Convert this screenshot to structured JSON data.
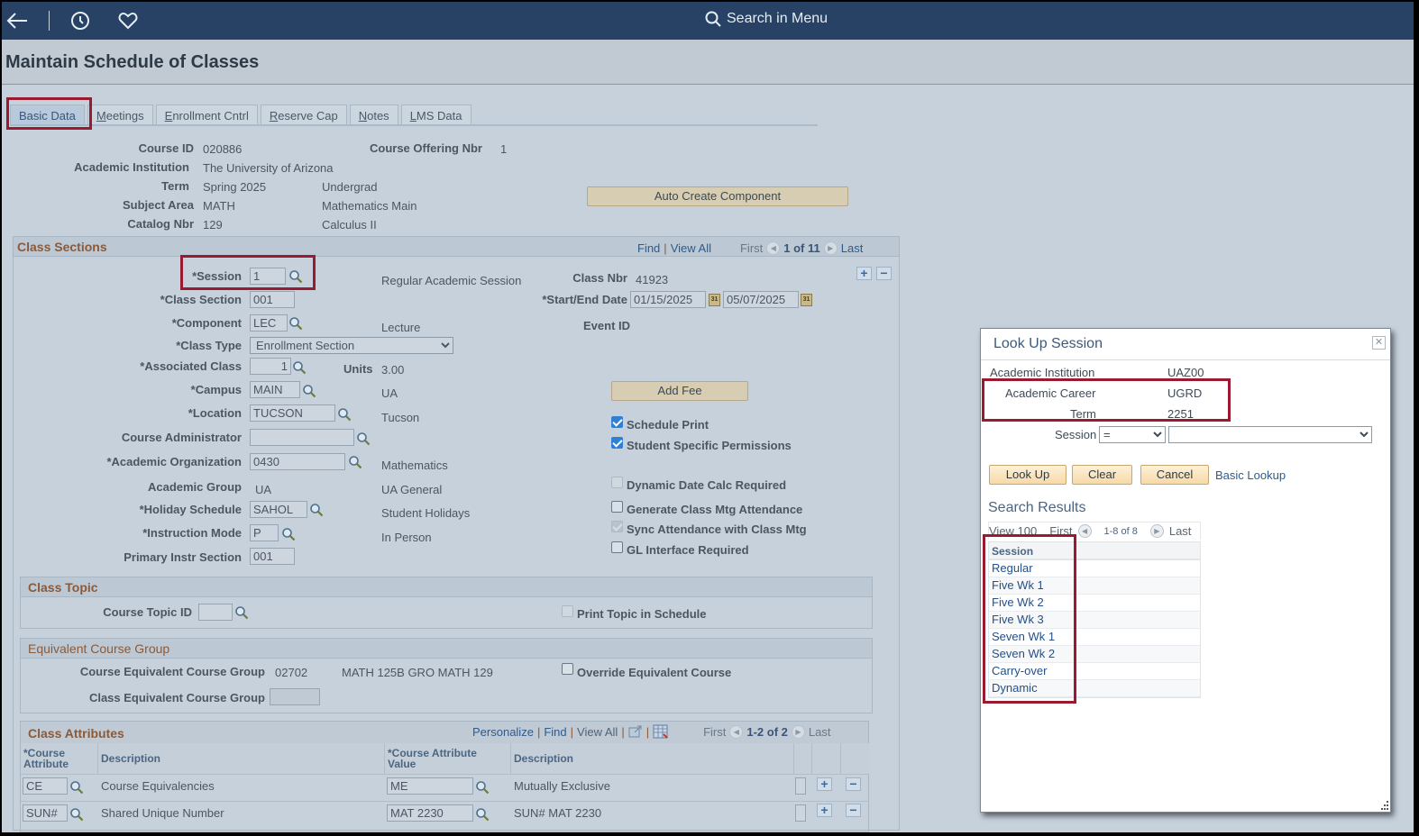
{
  "topbar": {
    "back_icon": "arrow-left-icon",
    "history_icon": "clock-icon",
    "favorites_icon": "heart-icon",
    "search_label": "Search in Menu"
  },
  "page": {
    "title": "Maintain Schedule of Classes"
  },
  "tabs": [
    {
      "pre": "",
      "ul": "",
      "post": "Basic Data",
      "active": true
    },
    {
      "pre": "",
      "ul": "M",
      "post": "eetings"
    },
    {
      "pre": "",
      "ul": "E",
      "post": "nrollment Cntrl"
    },
    {
      "pre": "",
      "ul": "R",
      "post": "eserve Cap"
    },
    {
      "pre": "",
      "ul": "N",
      "post": "otes"
    },
    {
      "pre": "",
      "ul": "L",
      "post": "MS Data"
    }
  ],
  "course": {
    "course_id_label": "Course ID",
    "course_id": "020886",
    "offering_label": "Course Offering Nbr",
    "offering": "1",
    "institution_label": "Academic Institution",
    "institution": "The University of Arizona",
    "term_label": "Term",
    "term": "Spring 2025",
    "career": "Undergrad",
    "subject_label": "Subject Area",
    "subject": "MATH",
    "subject_desc": "Mathematics Main",
    "catalog_label": "Catalog Nbr",
    "catalog": "129",
    "catalog_desc": "Calculus II",
    "auto_create_button": "Auto Create Component"
  },
  "class_sections": {
    "title": "Class Sections",
    "nav": {
      "find": "Find",
      "view_all": "View All",
      "first": "First",
      "count": "1 of 11",
      "last": "Last"
    },
    "session_label": "*Session",
    "session": "1",
    "session_desc": "Regular Academic Session",
    "class_nbr_label": "Class Nbr",
    "class_nbr": "41923",
    "section_label": "*Class Section",
    "section": "001",
    "dates_label": "*Start/End Date",
    "start_date": "01/15/2025",
    "end_date": "05/07/2025",
    "component_label": "*Component",
    "component": "LEC",
    "component_desc": "Lecture",
    "event_id_label": "Event ID",
    "class_type_label": "*Class Type",
    "class_type": "Enrollment Section",
    "assoc_label": "*Associated Class",
    "assoc": "1",
    "units_label": "Units",
    "units": "3.00",
    "campus_label": "*Campus",
    "campus": "MAIN",
    "campus_desc": "UA",
    "add_fee_button": "Add Fee",
    "location_label": "*Location",
    "location": "TUCSON",
    "location_desc": "Tucson",
    "admin_label": "Course Administrator",
    "admin": "",
    "org_label": "*Academic Organization",
    "org": "0430",
    "org_desc": "Mathematics",
    "group_label": "Academic Group",
    "group": "UA",
    "group_desc": "UA General",
    "holiday_label": "*Holiday Schedule",
    "holiday": "SAHOL",
    "holiday_desc": "Student Holidays",
    "mode_label": "*Instruction Mode",
    "mode": "P",
    "mode_desc": "In Person",
    "primary_label": "Primary Instr Section",
    "primary": "001",
    "checkboxes": {
      "schedule_print": {
        "label": "Schedule Print",
        "checked": true
      },
      "student_perm": {
        "label": "Student Specific Permissions",
        "checked": true
      },
      "dynamic_date": {
        "label": "Dynamic Date Calc Required",
        "checked": false,
        "disabled": true
      },
      "gen_attendance": {
        "label": "Generate Class Mtg Attendance",
        "checked": false
      },
      "sync_attendance": {
        "label": "Sync Attendance with Class Mtg",
        "checked": true,
        "disabled": true
      },
      "gl_interface": {
        "label": "GL Interface Required",
        "checked": false
      }
    }
  },
  "class_topic": {
    "title": "Class Topic",
    "topic_label": "Course Topic ID",
    "topic": "",
    "print_label": "Print Topic in Schedule"
  },
  "equiv": {
    "title": "Equivalent Course Group",
    "course_label": "Course Equivalent Course Group",
    "course_value": "02702",
    "course_desc": "MATH 125B GRO MATH 129",
    "override_label": "Override Equivalent Course",
    "class_label": "Class Equivalent Course Group",
    "class_value": ""
  },
  "attributes": {
    "title": "Class Attributes",
    "nav": {
      "personalize": "Personalize",
      "find": "Find",
      "view_all": "View All",
      "first": "First",
      "count": "1-2 of 2",
      "last": "Last"
    },
    "columns": [
      "*Course Attribute",
      "Description",
      "*Course Attribute Value",
      "Description"
    ],
    "rows": [
      {
        "attr": "CE",
        "desc": "Course Equivalencies",
        "value": "ME",
        "value_desc": "Mutually Exclusive"
      },
      {
        "attr": "SUN#",
        "desc": "Shared Unique Number",
        "value": "MAT 2230",
        "value_desc": "SUN# MAT 2230"
      }
    ]
  },
  "lookup": {
    "title": "Look Up Session",
    "institution_label": "Academic Institution",
    "institution": "UAZ00",
    "career_label": "Academic Career",
    "career": "UGRD",
    "term_label": "Term",
    "term": "2251",
    "session_label": "Session",
    "operator": "=",
    "session_value": "",
    "lookup_button": "Look Up",
    "clear_button": "Clear",
    "cancel_button": "Cancel",
    "basic_lookup": "Basic Lookup",
    "results_title": "Search Results",
    "view": "View 100",
    "first": "First",
    "count": "1-8 of 8",
    "last": "Last",
    "column": "Session",
    "results": [
      "Regular",
      "Five Wk 1",
      "Five Wk 2",
      "Five Wk 3",
      "Seven Wk 1",
      "Seven Wk 2",
      "Carry-over",
      "Dynamic"
    ]
  },
  "colors": {
    "topbar": "#274265",
    "highlight": "#9a1b30",
    "group_title": "#8a5a3a",
    "link": "#2e5a8c"
  }
}
